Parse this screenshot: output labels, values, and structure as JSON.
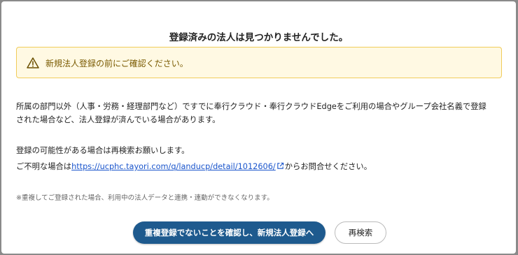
{
  "dialog": {
    "title": "登録済みの法人は見つかりませんでした。",
    "alert": {
      "icon": "warning-icon",
      "text": "新規法人登録の前にご確認ください。",
      "colors": {
        "background": "#fff9e3",
        "border": "#f0cc5a",
        "text": "#7a5a00"
      }
    },
    "paragraph1_line1": "所属の部門以外（人事・労務・経理部門など）ですでに奉行クラウド・奉行クラウドEdgeをご利用の場合やグループ会社名義で登録",
    "paragraph1_line2": "された場合など、法人登録が済んでいる場合があります。",
    "paragraph2": "登録の可能性がある場合は再検索お願いします。",
    "paragraph3_prefix": "ご不明な場合は",
    "link_text": "https://ucphc.tayori.com/q/landucp/detail/1012606/",
    "link_icon": "external-link-icon",
    "paragraph3_suffix": "からお問合せください。",
    "note": "※重複してご登録された場合、利用中の法人データと連携・連動ができなくなります。",
    "primary_button": "重複登録でないことを確認し、新規法人登録へ",
    "secondary_button": "再検索"
  },
  "colors": {
    "primary": "#1e5a8e",
    "link": "#1a55cc"
  }
}
